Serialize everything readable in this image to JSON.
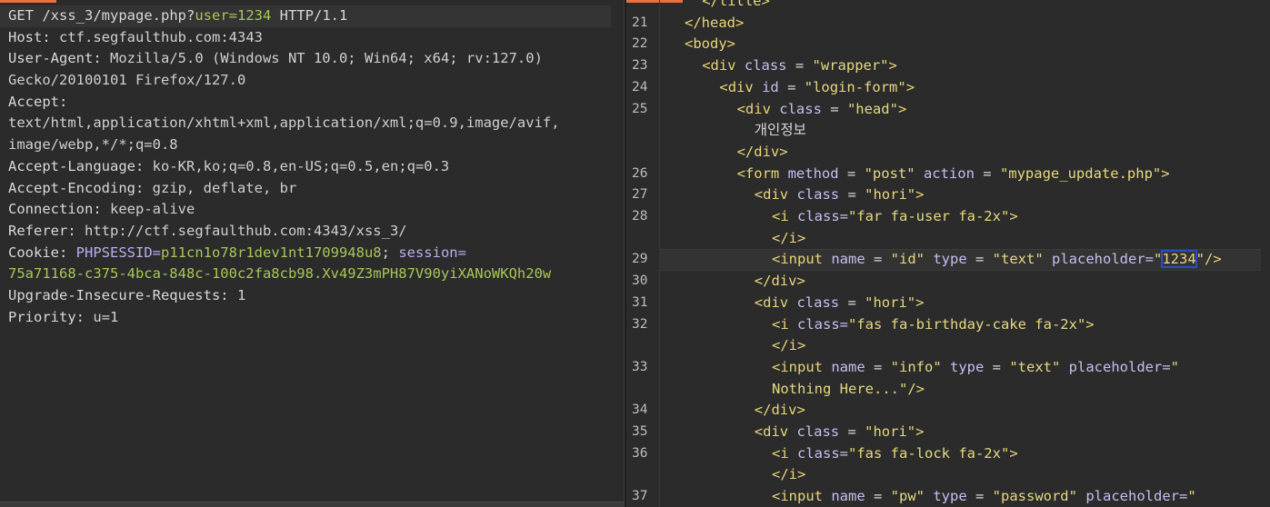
{
  "request": {
    "request_line": {
      "method": "GET",
      "path_prefix": "/xss_3/mypage.php?",
      "param_name": "user=",
      "param_value": "1234",
      "protocol": "HTTP/1.1"
    },
    "headers": [
      {
        "name": "Host:",
        "value": "ctf.segfaulthub.com:4343"
      },
      {
        "name": "User-Agent:",
        "value": "Mozilla/5.0 (Windows NT 10.0; Win64; x64; rv:127.0)"
      },
      {
        "name": "",
        "value": "Gecko/20100101 Firefox/127.0"
      },
      {
        "name": "Accept:",
        "value": ""
      },
      {
        "name": "",
        "value": "text/html,application/xhtml+xml,application/xml;q=0.9,image/avif,"
      },
      {
        "name": "",
        "value": "image/webp,*/*;q=0.8"
      },
      {
        "name": "Accept-Language:",
        "value": "ko-KR,ko;q=0.8,en-US;q=0.5,en;q=0.3"
      },
      {
        "name": "Accept-Encoding:",
        "value": "gzip, deflate, br"
      },
      {
        "name": "Connection:",
        "value": "keep-alive"
      },
      {
        "name": "Referer:",
        "value": "http://ctf.segfaulthub.com:4343/xss_3/"
      }
    ],
    "cookie": {
      "name": "Cookie:",
      "phpsessid_key": "PHPSESSID=",
      "phpsessid_value": "p11cn1o78r1dev1nt1709948u8",
      "sep": "; ",
      "session_key": "session=",
      "session_value": "75a71168-c375-4bca-848c-100c2fa8cb98.Xv49Z3mPH87V90yiXANoWKQh20w"
    },
    "tail_headers": [
      {
        "name": "Upgrade-Insecure-Requests:",
        "value": "1"
      },
      {
        "name": "Priority:",
        "value": "u=1"
      }
    ]
  },
  "response": {
    "lines": [
      {
        "num": "",
        "indent": 4,
        "parts": [
          [
            "tag",
            "</title>"
          ]
        ]
      },
      {
        "num": "21",
        "indent": 2,
        "parts": [
          [
            "tag",
            "</head>"
          ]
        ]
      },
      {
        "num": "22",
        "indent": 2,
        "parts": [
          [
            "tag",
            "<body>"
          ]
        ]
      },
      {
        "num": "23",
        "indent": 4,
        "parts": [
          [
            "tag",
            "<div "
          ],
          [
            "attr",
            "class"
          ],
          [
            "eq",
            " = "
          ],
          [
            "str",
            "\"wrapper\""
          ],
          [
            "tag",
            ">"
          ]
        ]
      },
      {
        "num": "24",
        "indent": 6,
        "parts": [
          [
            "tag",
            "<div "
          ],
          [
            "attr",
            "id"
          ],
          [
            "eq",
            " = "
          ],
          [
            "str",
            "\"login-form\""
          ],
          [
            "tag",
            ">"
          ]
        ]
      },
      {
        "num": "25",
        "indent": 8,
        "parts": [
          [
            "tag",
            "<div "
          ],
          [
            "attr",
            "class"
          ],
          [
            "eq",
            " = "
          ],
          [
            "str",
            "\"head\""
          ],
          [
            "tag",
            ">"
          ]
        ]
      },
      {
        "num": "",
        "indent": 10,
        "parts": [
          [
            "txt",
            "개인정보"
          ]
        ]
      },
      {
        "num": "",
        "indent": 8,
        "parts": [
          [
            "tag",
            "</div>"
          ]
        ]
      },
      {
        "num": "26",
        "indent": 8,
        "parts": [
          [
            "tag",
            "<form "
          ],
          [
            "attr",
            "method"
          ],
          [
            "eq",
            " = "
          ],
          [
            "str",
            "\"post\""
          ],
          [
            "eq",
            " "
          ],
          [
            "attr",
            "action"
          ],
          [
            "eq",
            " = "
          ],
          [
            "str",
            "\"mypage_update.php\""
          ],
          [
            "tag",
            ">"
          ]
        ]
      },
      {
        "num": "27",
        "indent": 10,
        "parts": [
          [
            "tag",
            "<div "
          ],
          [
            "attr",
            "class"
          ],
          [
            "eq",
            " = "
          ],
          [
            "str",
            "\"hori\""
          ],
          [
            "tag",
            ">"
          ]
        ]
      },
      {
        "num": "28",
        "indent": 12,
        "parts": [
          [
            "tag",
            "<i "
          ],
          [
            "attr",
            "class="
          ],
          [
            "str",
            "\"far fa-user fa-2x\""
          ],
          [
            "tag",
            ">"
          ]
        ]
      },
      {
        "num": "",
        "indent": 12,
        "parts": [
          [
            "tag",
            "</i>"
          ]
        ]
      },
      {
        "num": "29",
        "indent": 12,
        "cur": true,
        "parts": [
          [
            "tag",
            "<input "
          ],
          [
            "attr",
            "name"
          ],
          [
            "eq",
            " = "
          ],
          [
            "str",
            "\"id\""
          ],
          [
            "eq",
            " "
          ],
          [
            "attr",
            "type"
          ],
          [
            "eq",
            " = "
          ],
          [
            "str",
            "\"text\""
          ],
          [
            "eq",
            " "
          ],
          [
            "attr",
            "placeholder="
          ],
          [
            "str",
            "\""
          ],
          [
            "hl",
            "1234"
          ],
          [
            "str",
            "\""
          ],
          [
            "tag",
            "/>"
          ]
        ]
      },
      {
        "num": "30",
        "indent": 10,
        "parts": [
          [
            "tag",
            "</div>"
          ]
        ]
      },
      {
        "num": "31",
        "indent": 10,
        "parts": [
          [
            "tag",
            "<div "
          ],
          [
            "attr",
            "class"
          ],
          [
            "eq",
            " = "
          ],
          [
            "str",
            "\"hori\""
          ],
          [
            "tag",
            ">"
          ]
        ]
      },
      {
        "num": "32",
        "indent": 12,
        "parts": [
          [
            "tag",
            "<i "
          ],
          [
            "attr",
            "class="
          ],
          [
            "str",
            "\"fas fa-birthday-cake fa-2x\""
          ],
          [
            "tag",
            ">"
          ]
        ]
      },
      {
        "num": "",
        "indent": 12,
        "parts": [
          [
            "tag",
            "</i>"
          ]
        ]
      },
      {
        "num": "33",
        "indent": 12,
        "parts": [
          [
            "tag",
            "<input "
          ],
          [
            "attr",
            "name"
          ],
          [
            "eq",
            " = "
          ],
          [
            "str",
            "\"info\""
          ],
          [
            "eq",
            " "
          ],
          [
            "attr",
            "type"
          ],
          [
            "eq",
            " = "
          ],
          [
            "str",
            "\"text\""
          ],
          [
            "eq",
            " "
          ],
          [
            "attr",
            "placeholder="
          ],
          [
            "str",
            "\""
          ]
        ]
      },
      {
        "num": "",
        "indent": 12,
        "parts": [
          [
            "str",
            "Nothing Here...\""
          ],
          [
            "tag",
            "/>"
          ]
        ]
      },
      {
        "num": "34",
        "indent": 10,
        "parts": [
          [
            "tag",
            "</div>"
          ]
        ]
      },
      {
        "num": "35",
        "indent": 10,
        "parts": [
          [
            "tag",
            "<div "
          ],
          [
            "attr",
            "class"
          ],
          [
            "eq",
            " = "
          ],
          [
            "str",
            "\"hori\""
          ],
          [
            "tag",
            ">"
          ]
        ]
      },
      {
        "num": "36",
        "indent": 12,
        "parts": [
          [
            "tag",
            "<i "
          ],
          [
            "attr",
            "class="
          ],
          [
            "str",
            "\"fas fa-lock fa-2x\""
          ],
          [
            "tag",
            ">"
          ]
        ]
      },
      {
        "num": "",
        "indent": 12,
        "parts": [
          [
            "tag",
            "</i>"
          ]
        ]
      },
      {
        "num": "37",
        "indent": 12,
        "parts": [
          [
            "tag",
            "<input "
          ],
          [
            "attr",
            "name"
          ],
          [
            "eq",
            " = "
          ],
          [
            "str",
            "\"pw\""
          ],
          [
            "eq",
            " "
          ],
          [
            "attr",
            "type"
          ],
          [
            "eq",
            " = "
          ],
          [
            "str",
            "\"password\""
          ],
          [
            "eq",
            " "
          ],
          [
            "attr",
            "placeholder="
          ],
          [
            "str",
            "\""
          ]
        ]
      }
    ]
  },
  "colors": {
    "background": "#2b2b2b",
    "accent_tab": "#e8733a",
    "tag": "#e8d577",
    "attribute": "#c9bdf0",
    "string": "#e6d980",
    "param_value": "#a8c755",
    "highlight_outline": "#2a4bd0"
  }
}
